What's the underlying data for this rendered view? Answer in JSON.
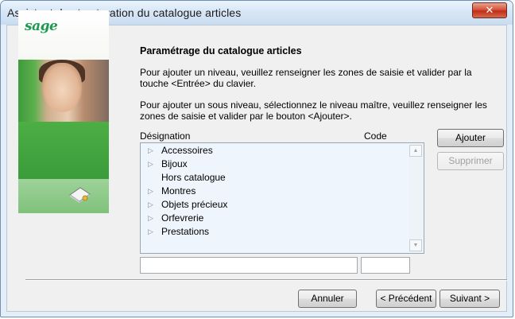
{
  "window": {
    "title": "Assistant de structuration du catalogue articles",
    "close_glyph": "✕"
  },
  "side_panel": {
    "logo_text": "sage",
    "cd_icon": "cd-install-icon"
  },
  "main": {
    "heading": "Paramétrage du catalogue articles",
    "paragraph1": "Pour ajouter un niveau, veuillez renseigner les zones de saisie et valider par la touche <Entrée> du clavier.",
    "paragraph2": "Pour ajouter un sous niveau, sélectionnez le niveau maître, veuillez renseigner les zones de saisie et valider par le bouton <Ajouter>."
  },
  "list": {
    "col_designation": "Désignation",
    "col_code": "Code",
    "items": [
      {
        "label": "Accessoires",
        "expandable": true
      },
      {
        "label": "Bijoux",
        "expandable": true
      },
      {
        "label": "Hors catalogue",
        "expandable": false
      },
      {
        "label": "Montres",
        "expandable": true
      },
      {
        "label": "Objets précieux",
        "expandable": true
      },
      {
        "label": "Orfevrerie",
        "expandable": true
      },
      {
        "label": "Prestations",
        "expandable": true
      }
    ],
    "expand_glyph": "▷",
    "scroll_up_glyph": "▲",
    "scroll_down_glyph": "▼"
  },
  "inputs": {
    "designation_value": "",
    "code_value": ""
  },
  "buttons": {
    "ajouter": "Ajouter",
    "supprimer": "Supprimer",
    "annuler": "Annuler",
    "precedent": "< Précédent",
    "suivant": "Suivant >"
  },
  "colors": {
    "list_background": "#eef5fc",
    "brand_green": "#1e9a4e",
    "close_red": "#c8402a"
  }
}
